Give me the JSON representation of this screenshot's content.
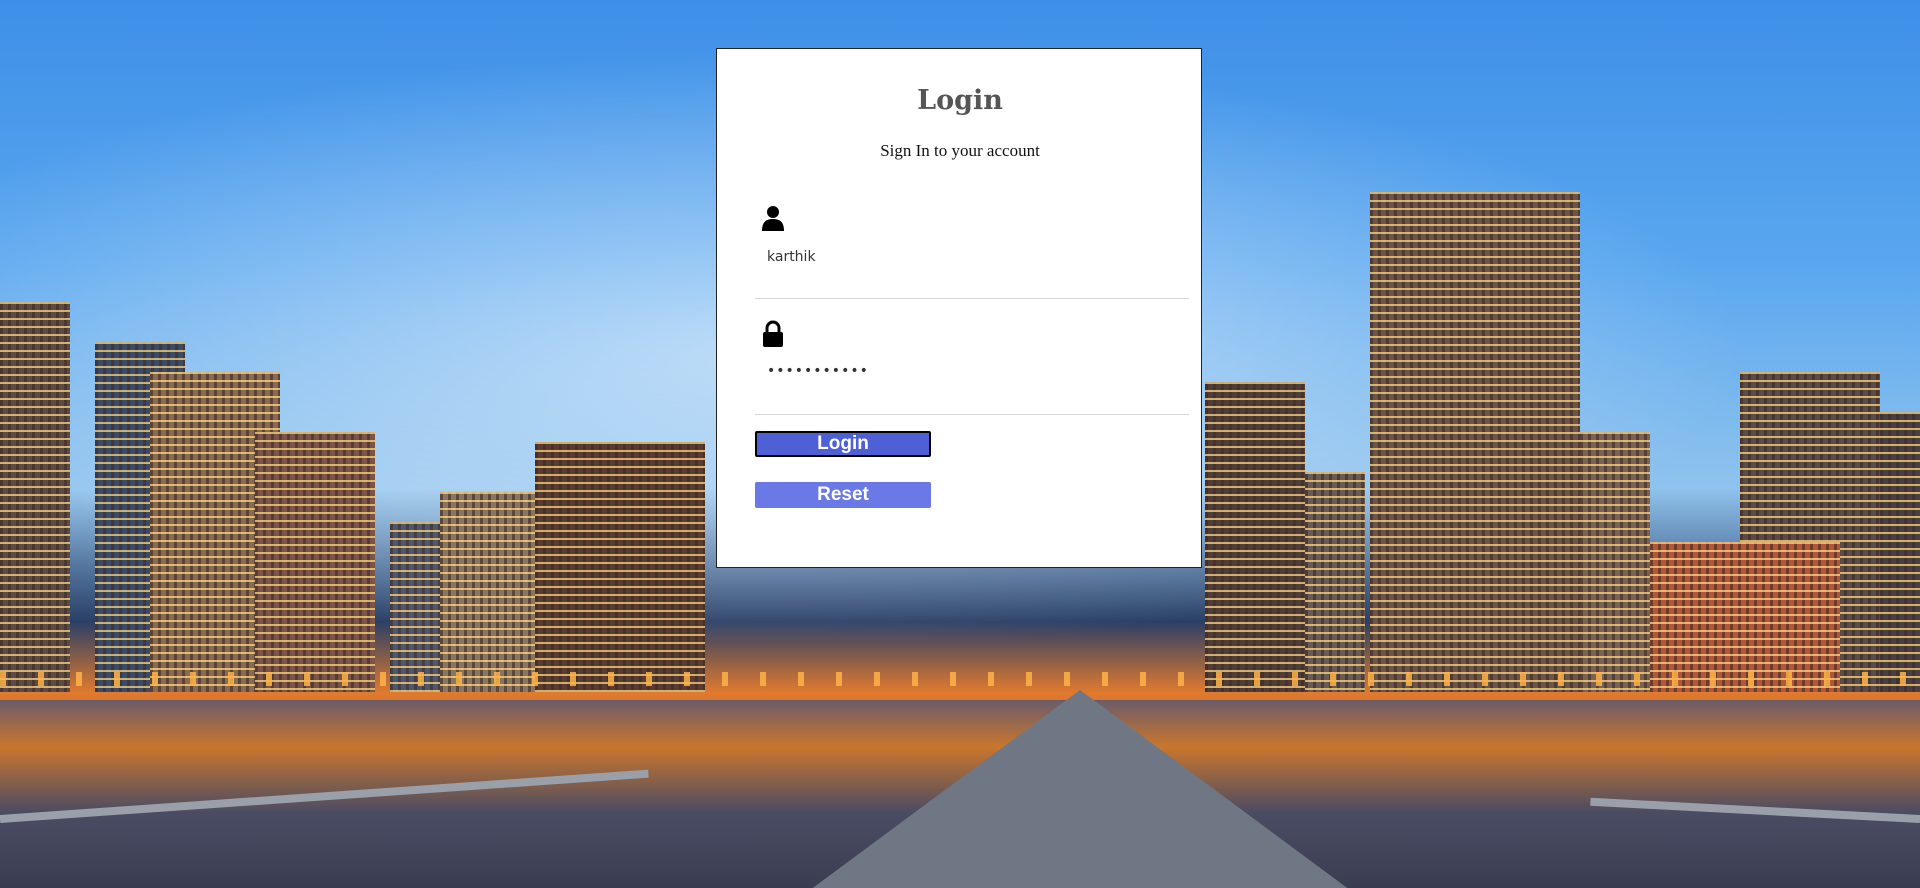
{
  "login": {
    "title": "Login",
    "subtitle": "Sign In to your account",
    "username": {
      "value": "karthik",
      "icon": "user-icon"
    },
    "password": {
      "value": "•••••••••••",
      "icon": "lock-icon"
    },
    "buttons": {
      "login_label": "Login",
      "reset_label": "Reset"
    }
  },
  "colors": {
    "login_button": "#4f5fd6",
    "reset_button": "#6b79e6",
    "title_text": "#555555"
  }
}
